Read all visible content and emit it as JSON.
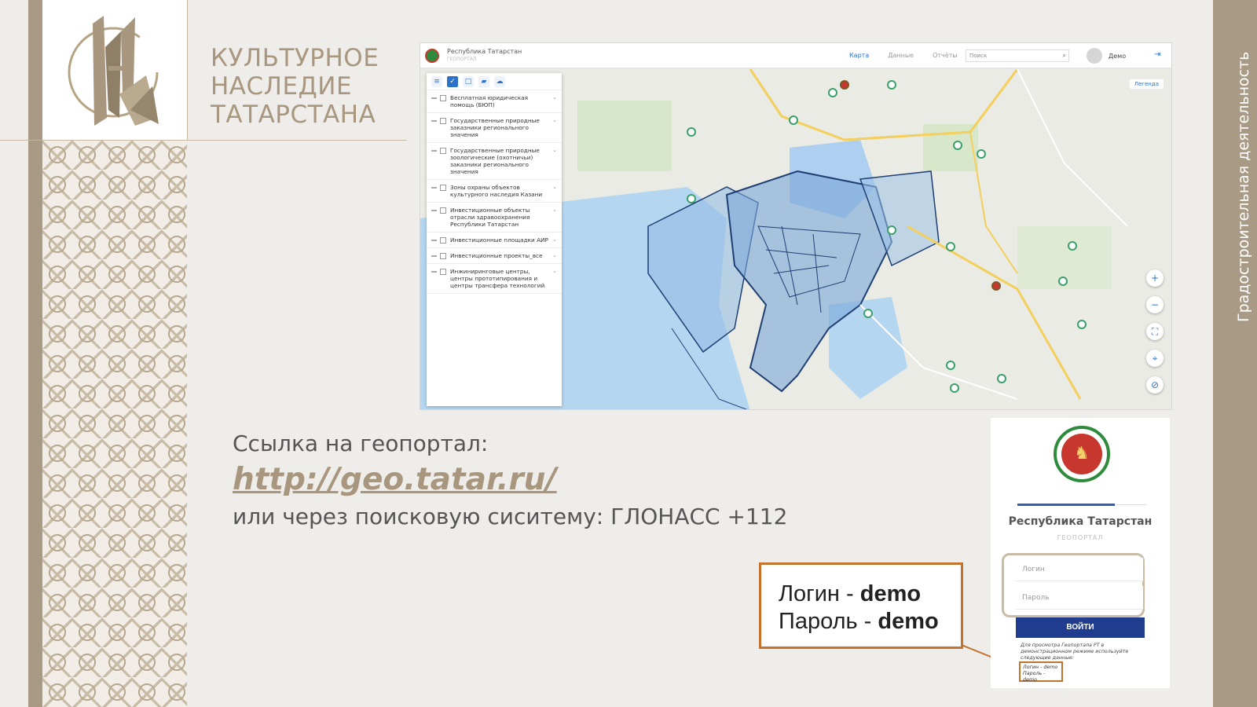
{
  "brand": {
    "title": "КУЛЬТУРНОЕ\nНАСЛЕДИЕ\nТАТАРСТАНА"
  },
  "side_band": {
    "text": "Градостроительная деятельность"
  },
  "geoportal": {
    "region": "Республика Татарстан",
    "region_sub": "ГЕОПОРТАЛ",
    "nav": [
      "Карта",
      "Данные",
      "Отчёты"
    ],
    "search_placeholder": "Поиск",
    "user": "Демо",
    "legend_label": "Легенда",
    "layers": [
      "Бесплатная юридическая помощь (БЮП)",
      "Государственные природные заказники регионального значения",
      "Государственные природные зоологические (охотничьи) заказники регионального значения",
      "Зоны охраны объектов культурного наследия Казани",
      "Инвестиционные объекты отрасли здравоохранения Республики Татарстан",
      "Инвестиционные площадки АИР",
      "Инвестиционные проекты_все",
      "Инжиниринговые центры, центры прототипирования и центры трансфера технологий"
    ],
    "colors": {
      "accent": "#2c72c9",
      "water": "#b5d6f1",
      "zone": "#6fa2d8"
    }
  },
  "link_block": {
    "heading": "Ссылка на геопортал:",
    "url": "http://geo.tatar.ru/",
    "alternative": "или через поисковую сиситему: ГЛОНАСС +112"
  },
  "credentials": {
    "login_label": "Логин - ",
    "login_value": "demo",
    "password_label": "Пароль - ",
    "password_value": "demo"
  },
  "login_card": {
    "title": "Республика Татарстан",
    "subtitle": "ГЕОПОРТАЛ",
    "login_placeholder": "Логин",
    "password_placeholder": "Пароль",
    "submit_label": "ВОЙТИ",
    "note": "Для просмотра Геопортала РТ в демонстрационном режиме используйте следующие данные:",
    "demo_login": "Логин - demo",
    "demo_password": "Пароль - demo"
  },
  "colors": {
    "brand_gold": "#a8977e",
    "highlight_orange": "#c4732f",
    "button_blue": "#203c8f"
  }
}
